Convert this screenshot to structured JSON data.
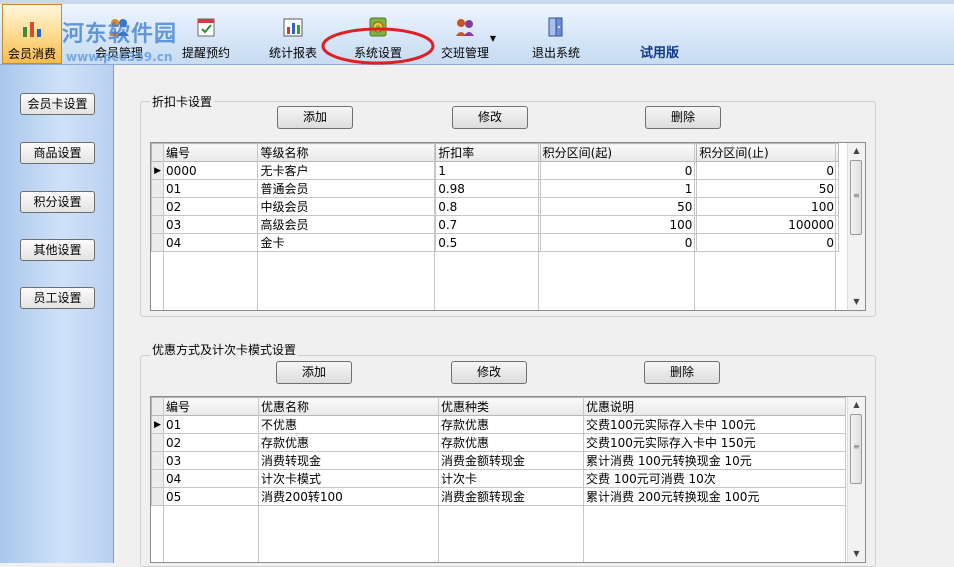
{
  "toolbar": {
    "items": [
      {
        "label": "会员消费"
      },
      {
        "label": "会员管理"
      },
      {
        "label": "提醒预约"
      },
      {
        "label": "统计报表"
      },
      {
        "label": "系统设置"
      },
      {
        "label": "交班管理"
      },
      {
        "label": "退出系统"
      }
    ],
    "trial_label": "试用版",
    "watermark_title": "河东软件园",
    "watermark_url": "www.pc0359.cn"
  },
  "sidebar": {
    "items": [
      {
        "label": "会员卡设置"
      },
      {
        "label": "商品设置"
      },
      {
        "label": "积分设置"
      },
      {
        "label": "其他设置"
      },
      {
        "label": "员工设置"
      }
    ]
  },
  "discount": {
    "title": "折扣卡设置",
    "add_label": "添加",
    "edit_label": "修改",
    "delete_label": "删除",
    "columns": [
      "编号",
      "等级名称",
      "折扣率",
      "积分区间(起)",
      "积分区间(止)"
    ],
    "rows": [
      [
        "0000",
        "无卡客户",
        "1",
        "0",
        "0"
      ],
      [
        "01",
        "普通会员",
        "0.98",
        "1",
        "50"
      ],
      [
        "02",
        "中级会员",
        "0.8",
        "50",
        "100"
      ],
      [
        "03",
        "高级会员",
        "0.7",
        "100",
        "100000"
      ],
      [
        "04",
        "金卡",
        "0.5",
        "0",
        "0"
      ]
    ]
  },
  "promo": {
    "title": "优惠方式及计次卡模式设置",
    "add_label": "添加",
    "edit_label": "修改",
    "delete_label": "删除",
    "columns": [
      "编号",
      "优惠名称",
      "优惠种类",
      "优惠说明"
    ],
    "rows": [
      [
        "01",
        "不优惠",
        "存款优惠",
        "交费100元实际存入卡中 100元"
      ],
      [
        "02",
        "存款优惠",
        "存款优惠",
        "交费100元实际存入卡中 150元"
      ],
      [
        "03",
        "消费转现金",
        "消费金额转现金",
        "累计消费 100元转换现金 10元"
      ],
      [
        "04",
        "计次卡模式",
        "计次卡",
        "交费 100元可消费 10次"
      ],
      [
        "05",
        "消费200转100",
        "消费金额转现金",
        "累计消费 200元转换现金 100元"
      ]
    ]
  },
  "colors": {
    "accent": "#123a8a",
    "annotation": "#e02020",
    "active_tab": "#f5bb4e"
  }
}
